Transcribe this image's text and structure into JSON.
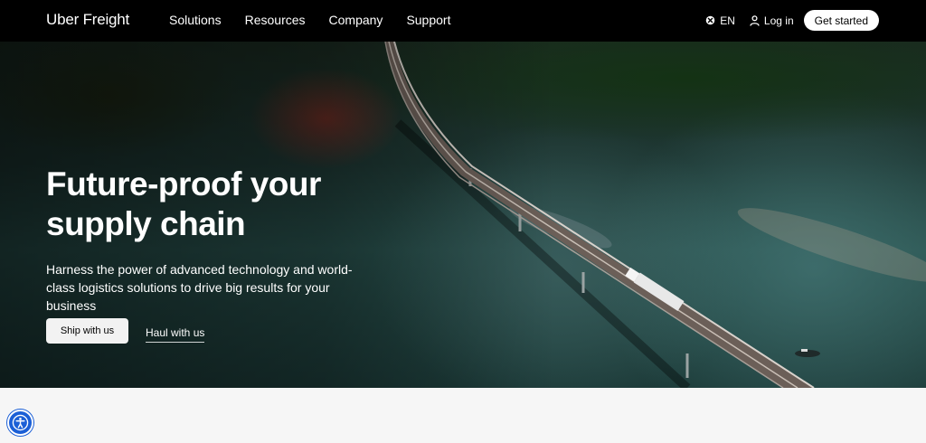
{
  "header": {
    "logo": "Uber Freight",
    "nav": [
      "Solutions",
      "Resources",
      "Company",
      "Support"
    ],
    "language": "EN",
    "login": "Log in",
    "cta": "Get started"
  },
  "hero": {
    "headline": "Future-proof your supply chain",
    "subtext": "Harness the power of advanced technology and world-class logistics solutions to drive big results for your business",
    "primary_button": "Ship with us",
    "secondary_button": "Haul with us"
  },
  "icons": {
    "language": "globe-icon",
    "login": "person-icon",
    "accessibility": "accessibility-icon"
  },
  "colors": {
    "header_bg": "#000000",
    "accent": "#1b5fd6",
    "page_bg": "#f6f6f6"
  }
}
